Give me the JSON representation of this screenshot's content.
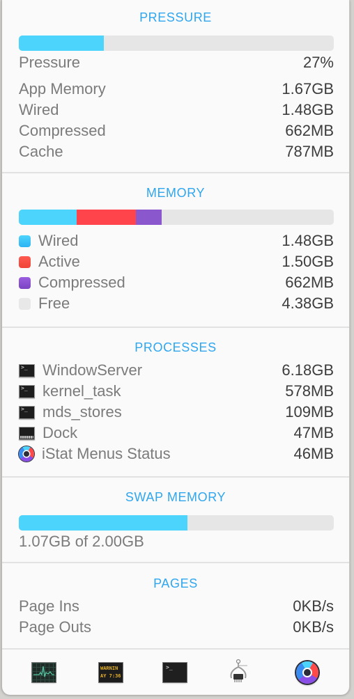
{
  "colors": {
    "accent": "#2fa6ee",
    "bar_fill": "#4cd4fd",
    "bar_track": "#e6e6e6",
    "wired": "#4cd4fd",
    "active": "#ff454b",
    "compressed": "#8a58cc",
    "free": "#e6e6e6"
  },
  "pressure": {
    "title": "PRESSURE",
    "percent": 27,
    "rows": [
      {
        "label": "Pressure",
        "value": "27%"
      }
    ],
    "details": [
      {
        "label": "App Memory",
        "value": "1.67GB"
      },
      {
        "label": "Wired",
        "value": "1.48GB"
      },
      {
        "label": "Compressed",
        "value": "662MB"
      },
      {
        "label": "Cache",
        "value": "787MB"
      }
    ]
  },
  "memory": {
    "title": "MEMORY",
    "segments": [
      {
        "label": "Wired",
        "value": "1.48GB",
        "gb": 1.48,
        "color": "#4cd4fd"
      },
      {
        "label": "Active",
        "value": "1.50GB",
        "gb": 1.5,
        "color": "#ff454b"
      },
      {
        "label": "Compressed",
        "value": "662MB",
        "gb": 0.662,
        "color": "#8a58cc"
      },
      {
        "label": "Free",
        "value": "4.38GB",
        "gb": 4.38,
        "color": "#e6e6e6"
      }
    ]
  },
  "processes": {
    "title": "PROCESSES",
    "items": [
      {
        "name": "WindowServer",
        "value": "6.18GB",
        "icon": "terminal-icon"
      },
      {
        "name": "kernel_task",
        "value": "578MB",
        "icon": "terminal-icon"
      },
      {
        "name": "mds_stores",
        "value": "109MB",
        "icon": "terminal-icon"
      },
      {
        "name": "Dock",
        "value": "47MB",
        "icon": "dock-icon"
      },
      {
        "name": "iStat Menus Status",
        "value": "46MB",
        "icon": "istat-icon"
      }
    ]
  },
  "swap": {
    "title": "SWAP MEMORY",
    "used_gb": 1.07,
    "total_gb": 2.0,
    "text": "1.07GB of 2.00GB"
  },
  "pages": {
    "title": "PAGES",
    "rows": [
      {
        "label": "Page Ins",
        "value": "0KB/s"
      },
      {
        "label": "Page Outs",
        "value": "0KB/s"
      }
    ]
  },
  "footer": {
    "apps": [
      {
        "name": "Activity Monitor",
        "icon": "activity-monitor-icon"
      },
      {
        "name": "Console",
        "icon": "console-icon",
        "text_line1": "WARNIN",
        "text_line2": "AY 7:36"
      },
      {
        "name": "Terminal",
        "icon": "terminal-app-icon",
        "prompt": ">_"
      },
      {
        "name": "System Information",
        "icon": "system-information-icon"
      },
      {
        "name": "iStat Menus",
        "icon": "istat-menus-icon"
      }
    ]
  }
}
